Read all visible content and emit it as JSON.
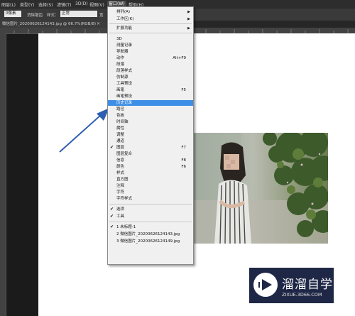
{
  "menubar": {
    "items": [
      "图层(L)",
      "类型(Y)",
      "选择(S)",
      "滤镜(T)",
      "3D(D)",
      "视图(V)",
      "窗口(W)",
      "帮助(H)"
    ]
  },
  "optbar": {
    "feather": "0像素",
    "anti_alias": "消除锯齿",
    "style_label": "样式：",
    "style_value": "正常",
    "width_label": "宽"
  },
  "tab": {
    "title": "微信图片_20200626124143.jpg @ 66.7%(RGB/8)",
    "close": "×"
  },
  "window_menu": {
    "items": [
      {
        "label": "排列(A)",
        "submenu": true
      },
      {
        "label": "工作区(K)",
        "submenu": true
      },
      {
        "label": "扩展功能",
        "submenu": true
      },
      {
        "label": "3D"
      },
      {
        "label": "测量记录"
      },
      {
        "label": "导航器"
      },
      {
        "label": "动作",
        "shortcut": "Alt+F9"
      },
      {
        "label": "段落"
      },
      {
        "label": "段落样式"
      },
      {
        "label": "仿制源"
      },
      {
        "label": "工具预设"
      },
      {
        "label": "画笔",
        "shortcut": "F5"
      },
      {
        "label": "画笔预设"
      },
      {
        "label": "历史记录",
        "highlighted": true
      },
      {
        "label": "路径"
      },
      {
        "label": "色板"
      },
      {
        "label": "时间轴"
      },
      {
        "label": "属性"
      },
      {
        "label": "调整"
      },
      {
        "label": "通道"
      },
      {
        "label": "图层",
        "checked": true,
        "shortcut": "F7"
      },
      {
        "label": "图层复合"
      },
      {
        "label": "信息",
        "shortcut": "F8"
      },
      {
        "label": "颜色",
        "shortcut": "F6"
      },
      {
        "label": "样式"
      },
      {
        "label": "直方图"
      },
      {
        "label": "注释"
      },
      {
        "label": "字符"
      },
      {
        "label": "字符样式"
      },
      {
        "label": "选项",
        "checked": true
      },
      {
        "label": "工具",
        "checked": true
      },
      {
        "label": "1 未标题-1",
        "checked": true
      },
      {
        "label": "2 微信图片_20200626124143.jpg"
      },
      {
        "label": "3 微信图片_20200626124149.jpg"
      }
    ]
  },
  "watermark": {
    "title": "溜溜自学",
    "url": "ZIXUE.3D66.COM"
  },
  "colors": {
    "highlight": "#3d8ee6",
    "arrow": "#2f5fb0",
    "watermark_bg": "#1f2746"
  }
}
